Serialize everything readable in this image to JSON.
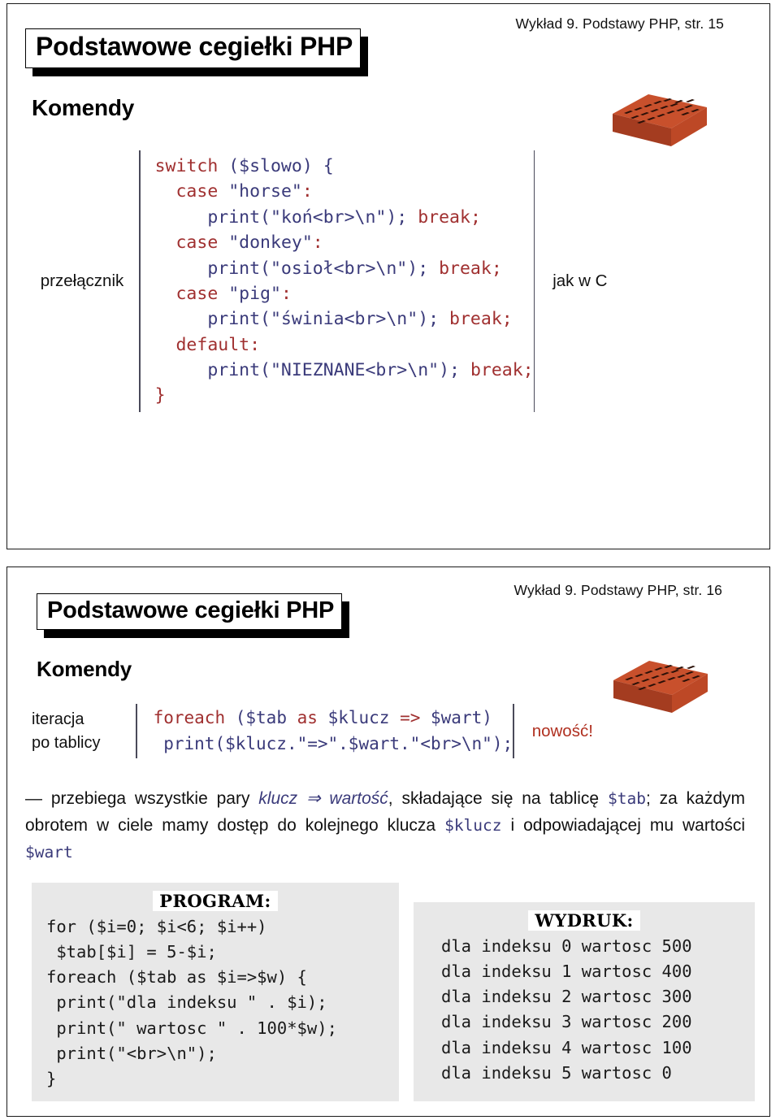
{
  "document": {
    "title": "Podstawowe cegiełki PHP",
    "brick_color": "#c0502a",
    "keyword_color": "#a03030",
    "variable_color": "#3a3a7a"
  },
  "slides": [
    {
      "header": "Wykład 9. Podstawy PHP, str. 15",
      "title": "Podstawowe cegiełki PHP",
      "section": "Komendy",
      "brick_icon": "brick-image",
      "demo": {
        "label": "przełącznik",
        "note": "jak w C",
        "code_lines": [
          "switch ($slowo) {",
          "  case \"horse\":",
          "     print(\"koń<br>\\n\"); break;",
          "  case \"donkey\":",
          "     print(\"osioł<br>\\n\"); break;",
          "  case \"pig\":",
          "     print(\"świnia<br>\\n\"); break;",
          "  default:",
          "     print(\"NIEZNANE<br>\\n\"); break;",
          "}"
        ]
      }
    },
    {
      "header": "Wykład 9. Podstawy PHP, str. 16",
      "title": "Podstawowe cegiełki PHP",
      "section": "Komendy",
      "brick_icon": "brick-image",
      "demo": {
        "label_line1": "iteracja",
        "label_line2": "po tablicy",
        "note": "nowość!",
        "code_lines": [
          "foreach ($tab as $klucz => $wart)",
          " print($klucz.\"=>\".$wart.\"<br>\\n\");"
        ]
      },
      "paragraph": {
        "dash": "—",
        "t1": " przebiega wszystkie pary ",
        "em": "klucz ⇒ wartość",
        "t2": ", składające się na tablicę ",
        "v1": "$tab",
        "t3": "; za każdym obrotem w ciele mamy dostęp do kolejnego klucza ",
        "v2": "$klucz",
        "t4": " i odpowiadającej mu wartości ",
        "v3": "$wart"
      },
      "program_box": {
        "caption": "PROGRAM:",
        "lines": [
          "for ($i=0; $i<6; $i++)",
          " $tab[$i] = 5-$i;",
          "foreach ($tab as $i=>$w) {",
          " print(\"dla indeksu \" . $i);",
          " print(\" wartosc \" . 100*$w);",
          " print(\"<br>\\n\");",
          "}"
        ]
      },
      "wydruk_box": {
        "caption": "WYDRUK:",
        "lines": [
          "dla indeksu 0 wartosc 500",
          "dla indeksu 1 wartosc 400",
          "dla indeksu 2 wartosc 300",
          "dla indeksu 3 wartosc 200",
          "dla indeksu 4 wartosc 100",
          "dla indeksu 5 wartosc 0"
        ]
      }
    }
  ]
}
